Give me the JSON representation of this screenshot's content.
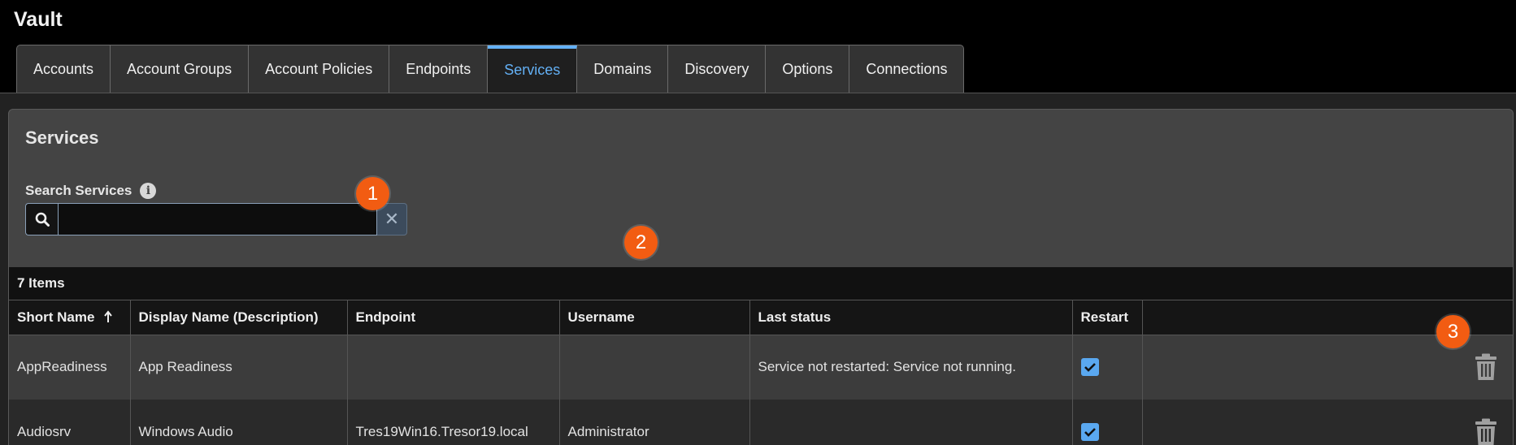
{
  "app": {
    "title": "Vault"
  },
  "tabs": [
    {
      "label": "Accounts",
      "active": false
    },
    {
      "label": "Account Groups",
      "active": false
    },
    {
      "label": "Account Policies",
      "active": false
    },
    {
      "label": "Endpoints",
      "active": false
    },
    {
      "label": "Services",
      "active": true
    },
    {
      "label": "Domains",
      "active": false
    },
    {
      "label": "Discovery",
      "active": false
    },
    {
      "label": "Options",
      "active": false
    },
    {
      "label": "Connections",
      "active": false
    }
  ],
  "panel": {
    "title": "Services",
    "search": {
      "label": "Search Services",
      "value": "",
      "placeholder": ""
    },
    "items_count": "7 Items"
  },
  "badges": [
    "1",
    "2",
    "3"
  ],
  "table": {
    "columns": [
      "Short Name",
      "Display Name (Description)",
      "Endpoint",
      "Username",
      "Last status",
      "Restart",
      ""
    ],
    "sort_icon": "arrow-up-icon",
    "rows": [
      {
        "short_name": "AppReadiness",
        "display_name": "App Readiness",
        "endpoint": "",
        "username": "",
        "last_status": "Service not restarted: Service not running.",
        "restart": true
      },
      {
        "short_name": "Audiosrv",
        "display_name": "Windows Audio",
        "endpoint": "Tres19Win16.Tresor19.local",
        "username": "Administrator",
        "last_status": "",
        "restart": true
      }
    ]
  },
  "colors": {
    "accent": "#63b0f5",
    "badge": "#f25c12",
    "checkbox": "#5aa8f0"
  }
}
